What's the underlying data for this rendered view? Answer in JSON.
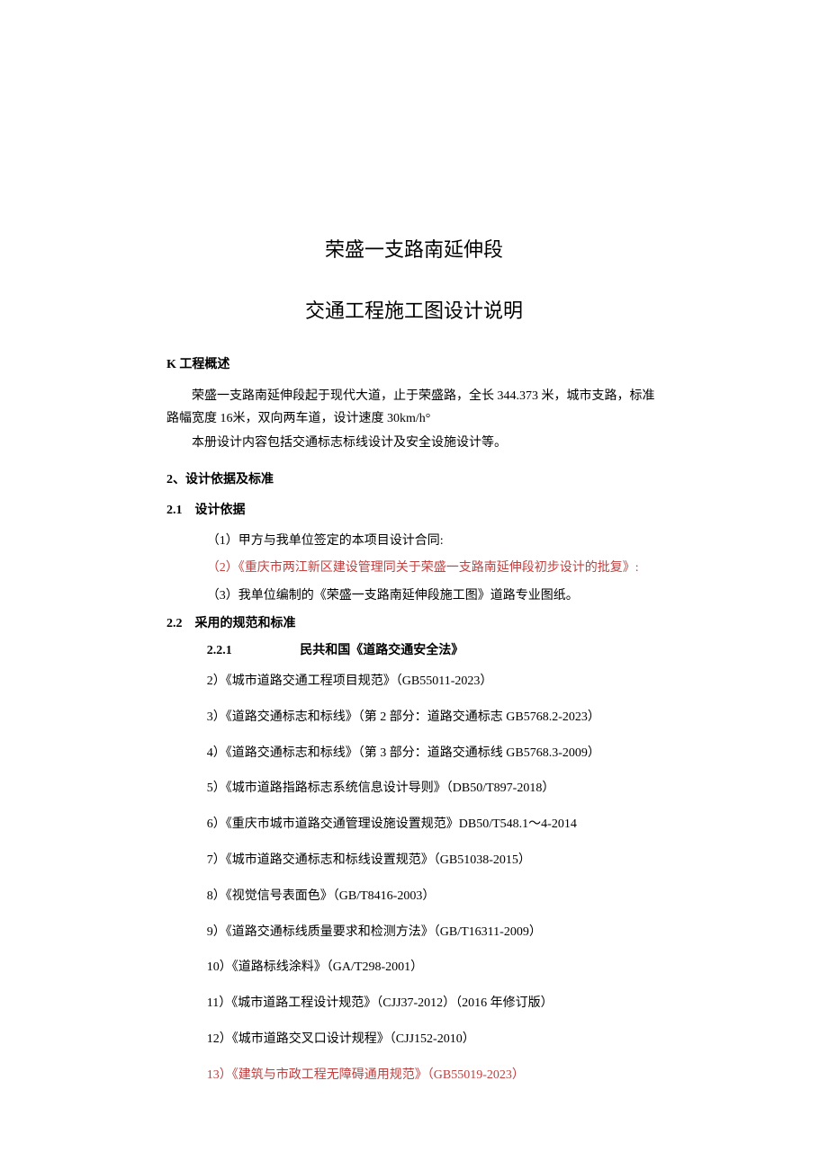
{
  "title_main": "荣盛一支路南延伸段",
  "title_sub": "交通工程施工图设计说明",
  "section_k": {
    "header": "K 工程概述",
    "p1": "荣盛一支路南延伸段起于现代大道，止于荣盛路，全长 344.373 米，城市支路，标准路幅宽度 16米，双向两车道，设计速度 30km/h°",
    "p2": "本册设计内容包括交通标志标线设计及安全设施设计等。"
  },
  "section_2": {
    "header": "2、设计依据及标准",
    "sub_2_1": {
      "header": "2.1　设计依据",
      "items": [
        "（1）甲方与我单位签定的本项目设计合同:",
        "（2）《重庆市两江新区建设管理同关于荣盛一支路南延伸段初步设计的批复》:",
        "（3）我单位编制的《荣盛一支路南延伸段施工图》道路专业图纸。"
      ]
    },
    "sub_2_2": {
      "header": "2.2　采用的规范和标准",
      "std_first": {
        "num": "2.2.1",
        "text": "民共和国《道路交通安全法》"
      },
      "items": [
        "2）《城市道路交通工程项目规范》（GB55011-2023）",
        "3）《道路交通标志和标线》（第 2 部分：道路交通标志 GB5768.2-2023）",
        "4）《道路交通标志和标线》（第 3 部分：道路交通标线 GB5768.3-2009）",
        "5）《城市道路指路标志系统信息设计导则》（DB50/T897-2018）",
        "6）《重庆市城市道路交通管理设施设置规范》DB50/T548.1～4-2014",
        "7）《城市道路交通标志和标线设置规范》（GB51038-2015）",
        "8）《视觉信号表面色》（GB/T8416-2003）",
        "9）《道路交通标线质量要求和检测方法》（GB/T16311-2009）",
        "10）《道路标线涂料》（GA/T298-2001）",
        "11）《城市道路工程设计规范》（CJJ37-2012）（2016 年修订版）",
        "12）《城市道路交叉口设计规程》（CJJ152-2010）",
        "13）《建筑与市政工程无障碍通用规范》（GB55019-2023）"
      ]
    }
  }
}
